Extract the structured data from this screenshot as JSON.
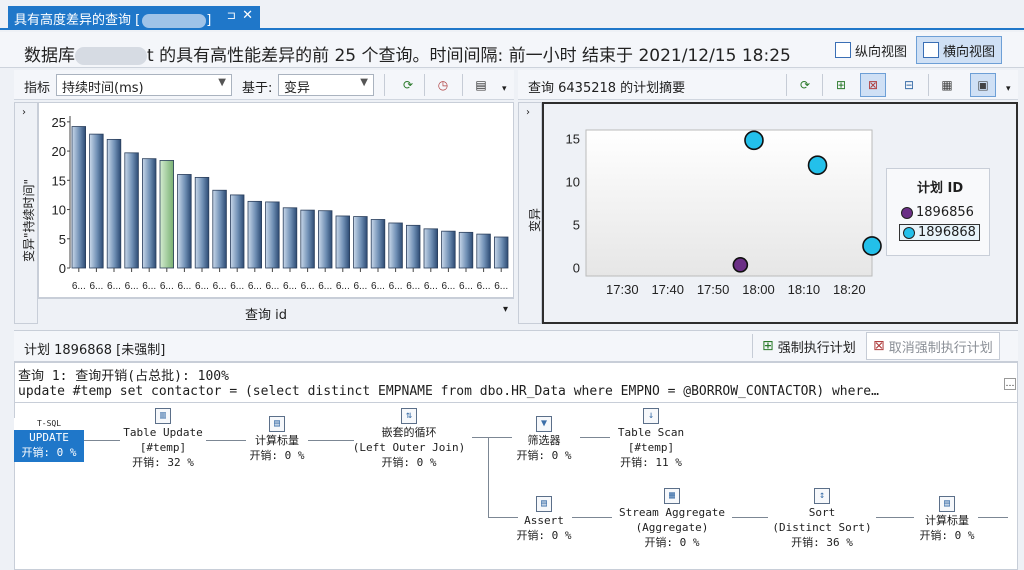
{
  "tab": {
    "title": "具有高度差异的查询 [",
    "title_end": "]",
    "pin": "⊐",
    "close": "✕"
  },
  "header": {
    "title_prefix": "数据库",
    "title_suffix": "t 的具有高性能差异的前 25 个查询。时间间隔: 前一小时 结束于 2021/12/15 18:25"
  },
  "views": {
    "vertical": "纵向视图",
    "horizontal": "横向视图"
  },
  "left_toolbar": {
    "metric_label": "指标",
    "metric_value": "持续时间(ms)",
    "based_on_label": "基于:",
    "based_on_value": "变异"
  },
  "right_toolbar": {
    "summary_title": "查询 6435218 的计划摘要"
  },
  "bar_chart": {
    "ylabel": "变异\"持续时间\"",
    "xlabel": "查询 id",
    "tick_label": "6...",
    "yticks": [
      "25",
      "20",
      "15",
      "10",
      "5",
      "0"
    ]
  },
  "chart_data": [
    {
      "type": "bar",
      "title": "",
      "xlabel": "查询 id",
      "ylabel": "变异\"持续时间\"",
      "ylim": [
        0,
        26
      ],
      "categories": [
        "6...",
        "6...",
        "6...",
        "6...",
        "6...",
        "6...",
        "6...",
        "6...",
        "6...",
        "6...",
        "6...",
        "6...",
        "6...",
        "6...",
        "6...",
        "6...",
        "6...",
        "6...",
        "6...",
        "6...",
        "6...",
        "6...",
        "6...",
        "6...",
        "6..."
      ],
      "values": [
        24.2,
        22.9,
        22.0,
        19.7,
        18.7,
        18.4,
        16.0,
        15.5,
        13.3,
        12.5,
        11.4,
        11.3,
        10.3,
        9.9,
        9.8,
        8.9,
        8.8,
        8.3,
        7.7,
        7.3,
        6.7,
        6.3,
        6.1,
        5.8,
        5.3
      ],
      "highlight_index": 5,
      "colors": {
        "bar": "#3b5f8c",
        "highlight": "#8fbf8a"
      }
    },
    {
      "type": "scatter",
      "title": "",
      "xlabel": "",
      "ylabel": "变异",
      "xlim": [
        "17:22",
        "18:25"
      ],
      "ylim": [
        -1,
        16
      ],
      "xticks": [
        "17:30",
        "17:40",
        "17:50",
        "18:00",
        "18:10",
        "18:20"
      ],
      "yticks": [
        "15",
        "10",
        "5",
        "0"
      ],
      "legend_title": "计划 ID",
      "series": [
        {
          "name": "1896856",
          "color": "#6b2f86",
          "points": [
            {
              "x": "17:56",
              "y": 0.3
            }
          ]
        },
        {
          "name": "1896868",
          "color": "#23c0ea",
          "points": [
            {
              "x": "17:59",
              "y": 14.8
            },
            {
              "x": "18:13",
              "y": 11.9
            },
            {
              "x": "18:25",
              "y": 2.5
            }
          ]
        }
      ]
    }
  ],
  "plan_bar": {
    "title": "计划 1896868 [未强制]",
    "force": "强制执行计划",
    "unforce": "取消强制执行计划"
  },
  "plan": {
    "line1": "查询 1: 查询开销(占总批): 100%",
    "line2": "update #temp set contactor = (select distinct EMPNAME from dbo.HR_Data where EMPNO = @BORROW_CONTACTOR) where…",
    "nodes": {
      "update": {
        "tag": "T-SQL",
        "name": "UPDATE",
        "cost": "开销: 0 %"
      },
      "table_update": {
        "name": "Table Update",
        "obj": "[#temp]",
        "cost": "开销: 32 %"
      },
      "compute1": {
        "name": "计算标量",
        "cost": "开销: 0 %"
      },
      "nested": {
        "name": "嵌套的循环",
        "sub": "(Left Outer Join)",
        "cost": "开销: 0 %"
      },
      "filter": {
        "name": "筛选器",
        "cost": "开销: 0 %"
      },
      "table_scan": {
        "name": "Table Scan",
        "obj": "[#temp]",
        "cost": "开销: 11 %"
      },
      "assert": {
        "name": "Assert",
        "cost": "开销: 0 %"
      },
      "stream": {
        "name": "Stream Aggregate",
        "sub": "(Aggregate)",
        "cost": "开销: 0 %"
      },
      "sort": {
        "name": "Sort",
        "sub": "(Distinct Sort)",
        "cost": "开销: 36 %"
      },
      "compute2": {
        "name": "计算标量",
        "cost": "开销: 0 %"
      }
    }
  }
}
